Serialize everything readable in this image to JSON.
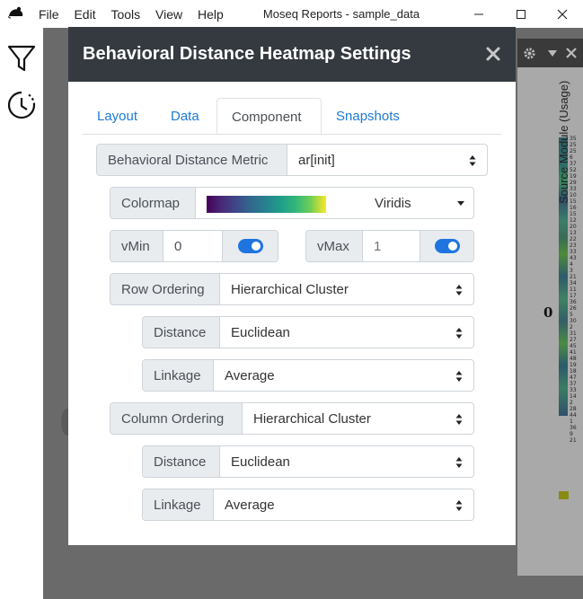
{
  "menu": [
    "File",
    "Edit",
    "Tools",
    "View",
    "Help"
  ],
  "window_title": "Moseq Reports - sample_data",
  "plot": {
    "axis_label": "Source Module (Usage)",
    "marker": "0",
    "ticks": [
      "35",
      "25",
      "25",
      "6",
      "37",
      "52",
      "19",
      "29",
      "33",
      "10",
      "15",
      "16",
      "15",
      "12",
      "20",
      "13",
      "22",
      "23",
      "33",
      "43",
      "4",
      "3",
      "21",
      "34",
      "11",
      "17",
      "36",
      "26",
      "5",
      "30",
      "2",
      "31",
      "27",
      "45",
      "41",
      "48",
      "19",
      "18",
      "47",
      "37",
      "33",
      "14",
      "2",
      "28",
      "44",
      "1",
      "36",
      "9",
      "21"
    ]
  },
  "modal": {
    "title": "Behavioral Distance Heatmap Settings",
    "tabs": [
      "Layout",
      "Data",
      "Component",
      "Snapshots"
    ],
    "active_tab": "Component",
    "metric": {
      "label": "Behavioral Distance Metric",
      "value": "ar[init]"
    },
    "colormap": {
      "label": "Colormap",
      "value": "Viridis"
    },
    "vmin": {
      "label": "vMin",
      "value": "0",
      "enabled": true
    },
    "vmax": {
      "label": "vMax",
      "value": "1",
      "enabled": true
    },
    "row_ordering": {
      "label": "Row Ordering",
      "value": "Hierarchical Cluster",
      "distance": {
        "label": "Distance",
        "value": "Euclidean"
      },
      "linkage": {
        "label": "Linkage",
        "value": "Average"
      }
    },
    "column_ordering": {
      "label": "Column Ordering",
      "value": "Hierarchical Cluster",
      "distance": {
        "label": "Distance",
        "value": "Euclidean"
      },
      "linkage": {
        "label": "Linkage",
        "value": "Average"
      }
    }
  },
  "colors": {
    "accent": "#1f75e0",
    "header": "#343a40",
    "link": "#1e7ad4"
  }
}
